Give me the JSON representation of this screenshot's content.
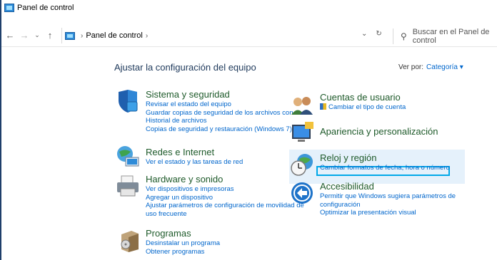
{
  "window": {
    "title": "Panel de control"
  },
  "nav": {
    "back_icon": "back-arrow-icon",
    "forward_icon": "forward-arrow-icon",
    "recent_icon": "chevron-down-icon",
    "up_icon": "up-arrow-icon",
    "breadcrumb": [
      "Panel de control"
    ],
    "search_placeholder": "Buscar en el Panel de control"
  },
  "main": {
    "heading": "Ajustar la configuración del equipo",
    "view_by_label": "Ver por:",
    "view_by_value": "Categoría",
    "categories": [
      {
        "title": "Sistema y seguridad",
        "icon": "shield-icon",
        "links": [
          "Revisar el estado del equipo",
          "Guardar copias de seguridad de los archivos con",
          "Historial de archivos",
          "Copias de seguridad y restauración (Windows 7)"
        ]
      },
      {
        "title": "Redes e Internet",
        "icon": "network-globe-icon",
        "links": [
          "Ver el estado y las tareas de red"
        ]
      },
      {
        "title": "Hardware y sonido",
        "icon": "printer-icon",
        "links": [
          "Ver dispositivos e impresoras",
          "Agregar un dispositivo",
          "Ajustar parámetros de configuración de movilidad de",
          "uso frecuente"
        ]
      },
      {
        "title": "Programas",
        "icon": "programs-box-icon",
        "links": [
          "Desinstalar un programa",
          "Obtener programas"
        ]
      },
      {
        "title": "Cuentas de usuario",
        "icon": "users-icon",
        "links": [
          "Cambiar el tipo de cuenta"
        ]
      },
      {
        "title": "Apariencia y personalización",
        "icon": "monitor-icon",
        "links": []
      },
      {
        "title": "Reloj y región",
        "icon": "clock-globe-icon",
        "links": [
          "Cambiar formatos de fecha, hora o número"
        ]
      },
      {
        "title": "Accesibilidad",
        "icon": "accessibility-icon",
        "links": [
          "Permitir que Windows sugiera parámetros de",
          "configuración",
          "Optimizar la presentación visual"
        ]
      }
    ]
  },
  "colors": {
    "accent": "#0066cc",
    "category_title": "#1e5a2a",
    "focus": "#00a8e8",
    "hover": "#e5f1fb"
  }
}
